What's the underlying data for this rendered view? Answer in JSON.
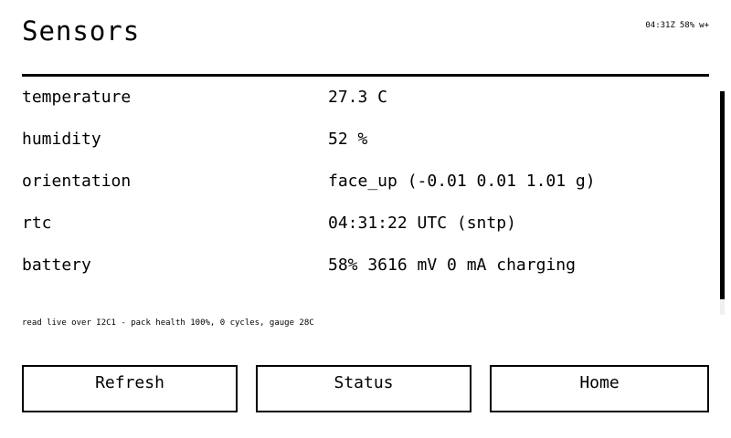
{
  "header": {
    "title": "Sensors",
    "clock": "04:31Z",
    "battery": "58%",
    "wifi": "w+"
  },
  "sensors": [
    {
      "key": "temperature",
      "value": "27.3 C"
    },
    {
      "key": "humidity",
      "value": "52 %"
    },
    {
      "key": "orientation",
      "value": "face_up (-0.01 0.01 1.01 g)"
    },
    {
      "key": "rtc",
      "value": "04:31:22 UTC (sntp)"
    },
    {
      "key": "battery",
      "value": "58% 3616 mV 0 mA charging"
    }
  ],
  "footnote": "read live over I2C1 - pack health 100%, 0 cycles, gauge 28C",
  "buttons": {
    "refresh": "Refresh",
    "status": "Status",
    "home": "Home"
  }
}
